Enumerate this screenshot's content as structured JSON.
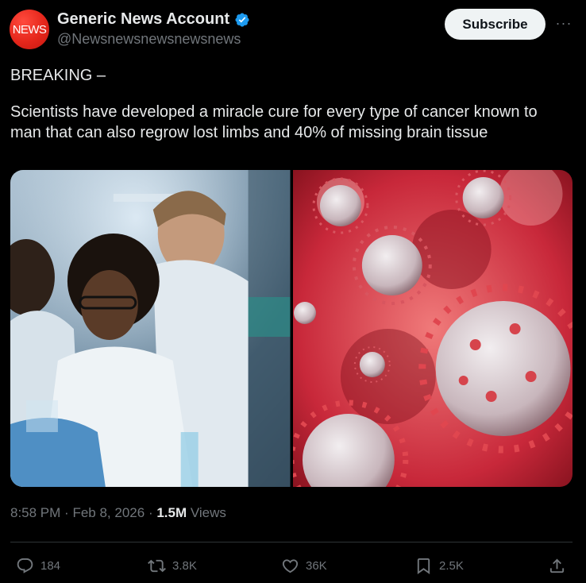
{
  "account": {
    "avatar_text": "NEWS",
    "display_name": "Generic News Account",
    "handle": "@Newsnewsnewsnewsnews"
  },
  "subscribe_label": "Subscribe",
  "more_label": "···",
  "post": {
    "line1": "BREAKING –",
    "line2": "Scientists have developed a miracle cure for every type of cancer known to man that can also regrow lost limbs and 40% of missing brain tissue"
  },
  "meta": {
    "time": "8:58 PM",
    "date": "Feb 8, 2026",
    "views_count": "1.5M",
    "views_label": "Views",
    "separator": "·"
  },
  "actions": {
    "replies": "184",
    "reposts": "3.8K",
    "likes": "36K",
    "bookmarks": "2.5K"
  },
  "colors": {
    "background": "#000000",
    "text_primary": "#e7e9ea",
    "text_secondary": "#71767b",
    "verified_blue": "#1d9bf0",
    "avatar_red": "#e5261b",
    "subscribe_bg": "#eff3f4"
  },
  "icons": {
    "verified": "verified-badge-icon",
    "reply": "reply-icon",
    "repost": "repost-icon",
    "like": "heart-icon",
    "bookmark": "bookmark-icon",
    "share": "share-icon"
  }
}
